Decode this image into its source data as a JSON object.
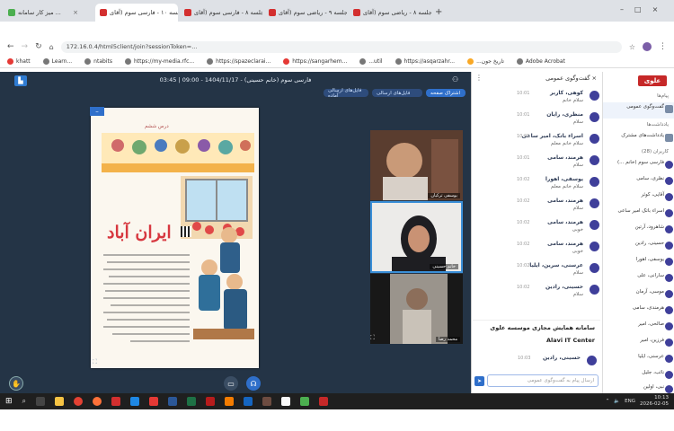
{
  "browser": {
    "tabs": [
      {
        "label": "میز کار سامانه ...",
        "color": "#4caf50"
      },
      {
        "label": "جلسه ۱۰ - فارسی سوم (آقای ...",
        "color": "#d32f2f",
        "active": true
      },
      {
        "label": "جلسه ۸ - فارسی سوم (آقای ...",
        "color": "#d32f2f"
      },
      {
        "label": "جلسه ۹ - ریاضی سوم (آقای ...",
        "color": "#d32f2f"
      },
      {
        "label": "جلسه ۸ - ریاضی سوم (آقای ...",
        "color": "#d32f2f"
      }
    ],
    "url": "172.16.0.4/html5client/join?sessionToken=...",
    "bookmarks": [
      "khatt",
      "Learn...",
      "ntabits",
      "https://my-media.rfc...",
      "https://spazeclarai...",
      "https://sangarhem...",
      "...util",
      "https://asqarzahr...",
      "...تاریخ جون",
      "Adobe Acrobat"
    ]
  },
  "conference": {
    "title": "فارسی سوم (خانم حسینی) - 1404/11/17 - 09:00 | 03:45",
    "pills": [
      "اشتراک صفحه",
      "فایل‌های ارسالی",
      "فایل‌های ارسالی آماده"
    ],
    "doc_title": "ایران آباد",
    "doc_header": "درس ششم",
    "video_labels": [
      "یوسفی ترکیان",
      "خانم حسینی",
      "محمد رضا"
    ]
  },
  "chat": {
    "header": "گفت‌وگوی عمومی",
    "messages": [
      {
        "name": "کوهی، کاربر",
        "body": "سلام خانم",
        "time": "10:01"
      },
      {
        "name": "منظری، رایان",
        "body": "سلام",
        "time": "10:01"
      },
      {
        "name": "اسراء باتک، امیر ساعی",
        "body": "سلام خانم معلم",
        "time": "10:01"
      },
      {
        "name": "هرمند، سامی",
        "body": "سلام",
        "time": "10:01"
      },
      {
        "name": "یوسفی، اهورا",
        "body": "سلام خانم معلم",
        "time": "10:02"
      },
      {
        "name": "هرمند، سامی",
        "body": "سلام",
        "time": "10:02"
      },
      {
        "name": "هرمند، سامی",
        "body": "خوبی",
        "time": "10:02"
      },
      {
        "name": "هرمند، سامی",
        "body": "خوبی",
        "time": "10:02"
      },
      {
        "name": "عرسنی، سرین، ایلیا",
        "body": "سلام",
        "time": "10:02"
      },
      {
        "name": "حسینی، رادین",
        "body": "سلام",
        "time": "10:02"
      }
    ],
    "banner_title": "سامانه همایش مجازی موسسه علوی",
    "banner_sub": "Alavi IT Center",
    "last_message": {
      "name": "حسینی، رادین",
      "time": "10:03"
    },
    "input_placeholder": "ارسال پیام به گفت‌وگوی عمومی"
  },
  "sidebar": {
    "logo": "علوی",
    "section_messages": "پیام‌ها",
    "public_chat": "گفت‌وگوی عمومی",
    "section_notes": "یادداشت‌ها",
    "shared_notes": "یادداشت‌های مشترک",
    "section_users": "کاربران (28)",
    "users": [
      "فارسی سوم (خانم ...)",
      "نظری، سامی",
      "آقایی، کوثر",
      "اسراء باتک امیر ساعی",
      "شاهرود، آرتین",
      "حسینی، رادین",
      "یوسفی، اهورا",
      "سارانی، علی",
      "موسی، آرمان",
      "هرمندی، سامی",
      "صالحی، امیر",
      "فرزین، امیر",
      "عرسنی، ایلیا",
      "نائب، جلیل",
      "نبی، اولین"
    ]
  },
  "taskbar": {
    "time": "10:13",
    "date": "2026-02-05",
    "lang": "ENG"
  }
}
